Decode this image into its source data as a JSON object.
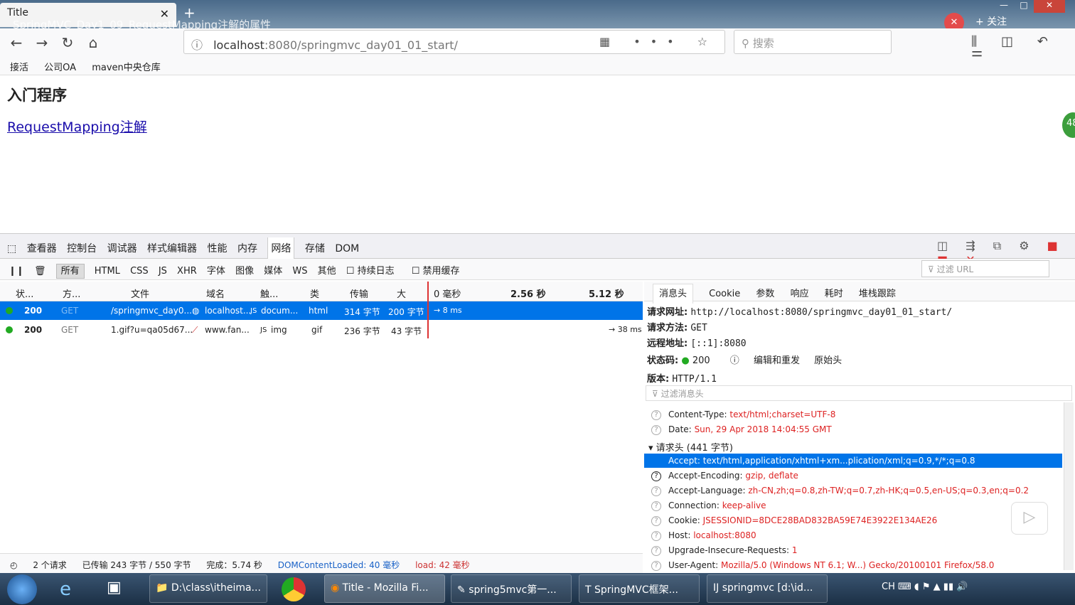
{
  "window": {
    "tab_title": "Title",
    "overlay_title": "SpringMVC_Day1_09_RequestMapping注解的属性",
    "follow_label": "+ 关注"
  },
  "navbar": {
    "url_host": "localhost",
    "url_rest": ":8080/springmvc_day01_01_start/",
    "search_placeholder": "搜索"
  },
  "bookmarks": [
    "接活",
    "公司OA",
    "maven中央仓库"
  ],
  "page": {
    "heading": "入门程序",
    "link": "RequestMapping注解",
    "side_badge": "48"
  },
  "devtools": {
    "tabs": [
      "查看器",
      "控制台",
      "调试器",
      "样式编辑器",
      "性能",
      "内存",
      "网络",
      "存储",
      "DOM"
    ],
    "active_tab": "网络",
    "filters": [
      "所有",
      "HTML",
      "CSS",
      "JS",
      "XHR",
      "字体",
      "图像",
      "媒体",
      "WS",
      "其他"
    ],
    "persist_log": "持续日志",
    "disable_cache": "禁用缓存",
    "filter_url_placeholder": "过滤 URL",
    "columns": [
      "状...",
      "方...",
      "文件",
      "域名",
      "触...",
      "类",
      "传输",
      "大",
      "0 毫秒",
      "2.56 秒",
      "5.12 秒"
    ],
    "requests": [
      {
        "status": "200",
        "method": "GET",
        "file": "/springmvc_day0...",
        "domain": "localhost...",
        "cause": "docum...",
        "type": "html",
        "transferred": "314 字节",
        "size": "200 字节",
        "timing": "→ 8 ms"
      },
      {
        "status": "200",
        "method": "GET",
        "file": "1.gif?u=qa05d67...",
        "domain": "www.fan...",
        "cause": "img",
        "type": "gif",
        "transferred": "236 字节",
        "size": "43 字节",
        "timing": "→ 38 ms"
      }
    ],
    "detail_tabs": [
      "消息头",
      "Cookie",
      "参数",
      "响应",
      "耗时",
      "堆栈跟踪"
    ],
    "summary": {
      "url_label": "请求网址:",
      "url": "http://localhost:8080/springmvc_day01_01_start/",
      "method_label": "请求方法:",
      "method": "GET",
      "remote_label": "远程地址:",
      "remote": "[::1]:8080",
      "status_label": "状态码:",
      "status": "200",
      "edit_resend": "编辑和重发",
      "raw_headers": "原始头",
      "version_label": "版本:",
      "version": "HTTP/1.1"
    },
    "filter_headers_placeholder": "过滤消息头",
    "response_headers": [
      {
        "k": "Content-Type:",
        "v": "text/html;charset=UTF-8"
      },
      {
        "k": "Date:",
        "v": "Sun, 29 Apr 2018 14:04:55 GMT"
      }
    ],
    "request_headers_title": "请求头 (441 字节)",
    "request_headers": [
      {
        "k": "Accept:",
        "v": "text/html,application/xhtml+xm...plication/xml;q=0.9,*/*;q=0.8"
      },
      {
        "k": "Accept-Encoding:",
        "v": "gzip, deflate"
      },
      {
        "k": "Accept-Language:",
        "v": "zh-CN,zh;q=0.8,zh-TW;q=0.7,zh-HK;q=0.5,en-US;q=0.3,en;q=0.2"
      },
      {
        "k": "Connection:",
        "v": "keep-alive"
      },
      {
        "k": "Cookie:",
        "v": "JSESSIONID=8DCE28BAD832BA59E74E3922E134AE26"
      },
      {
        "k": "Host:",
        "v": "localhost:8080"
      },
      {
        "k": "Upgrade-Insecure-Requests:",
        "v": "1"
      },
      {
        "k": "User-Agent:",
        "v": "Mozilla/5.0 (Windows NT 6.1; W...) Gecko/20100101 Firefox/58.0"
      }
    ],
    "status_bar": {
      "requests": "2 个请求",
      "transferred": "已传输 243 字节 / 550 字节",
      "finish": "完成：5.74 秒",
      "dcl": "DOMContentLoaded: 40 毫秒",
      "load": "load: 42 毫秒"
    }
  },
  "taskbar": {
    "items": [
      "D:\\class\\itheima...",
      "Title - Mozilla Fi...",
      "spring5mvc第一...",
      "SpringMVC框架...",
      "springmvc [d:\\id..."
    ],
    "tray": "CH"
  },
  "colors": {
    "accent": "#0074e8",
    "error": "#d22",
    "link": "#1a0dab"
  }
}
